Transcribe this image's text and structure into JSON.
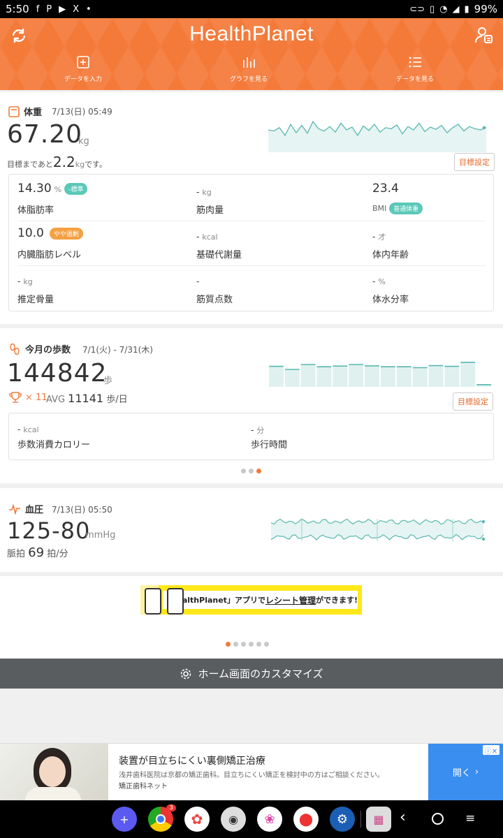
{
  "status": {
    "time": "5:50",
    "left_icons": [
      "facebook-icon",
      "pinterest-icon",
      "youtube-icon",
      "x-icon",
      "dot-icon"
    ],
    "battery": "99%"
  },
  "header": {
    "logo": "HealthPlanet",
    "nav": [
      {
        "label": "データを入力",
        "icon": "plus-square-icon"
      },
      {
        "label": "グラフを見る",
        "icon": "bar-chart-icon"
      },
      {
        "label": "データを見る",
        "icon": "list-icon"
      }
    ]
  },
  "weight": {
    "title": "体重",
    "date": "7/13(日) 05:49",
    "value": "67.20",
    "unit": "kg",
    "goal_prefix": "目標まであと",
    "goal_value": "2.2",
    "goal_unit": "kg",
    "goal_suffix": "です。",
    "goal_button": "目標設定",
    "metrics": [
      {
        "value": "14.30",
        "unit": "%",
        "badge": "-標準",
        "badge_color": "#5bc8b8",
        "label": "体脂肪率"
      },
      {
        "value": "-",
        "unit": "kg",
        "badge": "",
        "label": "筋肉量"
      },
      {
        "value": "23.4",
        "unit": "",
        "badge": "",
        "label": "BMI",
        "label_badge": "普通体重",
        "label_badge_color": "#5bc8b8"
      },
      {
        "value": "10.0",
        "unit": "",
        "badge": "やや過剰",
        "badge_color": "#f5a042",
        "label": "内臓脂肪レベル"
      },
      {
        "value": "-",
        "unit": "kcal",
        "badge": "",
        "label": "基礎代謝量"
      },
      {
        "value": "-",
        "unit": "才",
        "badge": "",
        "label": "体内年齢"
      },
      {
        "value": "-",
        "unit": "kg",
        "badge": "",
        "label": "推定骨量"
      },
      {
        "value": "-",
        "unit": "",
        "badge": "",
        "label": "筋質点数"
      },
      {
        "value": "-",
        "unit": "%",
        "badge": "",
        "label": "体水分率"
      }
    ],
    "sparkline": [
      40,
      38,
      44,
      30,
      50,
      35,
      48,
      34,
      55,
      42,
      38,
      46,
      36,
      52,
      40,
      45,
      30,
      47,
      39,
      50,
      36,
      44,
      42,
      49,
      33,
      46,
      40,
      52,
      37,
      45,
      41,
      48,
      35,
      44,
      50,
      38,
      46,
      42,
      40,
      44
    ]
  },
  "steps": {
    "title": "今月の歩数",
    "date": "7/1(火) - 7/31(木)",
    "value": "144842",
    "unit": "歩",
    "trophy_count": "× 11",
    "avg_label": "AVG",
    "avg_value": "11141",
    "avg_unit": "歩/日",
    "goal_button": "目標設定",
    "calories_value": "-",
    "calories_unit": "kcal",
    "calories_label": "歩数消費カロリー",
    "time_value": "-",
    "time_unit": "分",
    "time_label": "歩行時間",
    "bars": [
      0.92,
      0.78,
      1.0,
      0.9,
      0.93,
      1.0,
      0.94,
      0.9,
      0.9,
      0.86,
      0.95,
      0.92,
      1.1,
      0.1
    ]
  },
  "bp": {
    "title": "血圧",
    "date": "7/13(日) 05:50",
    "value": "125-80",
    "unit": "mmHg",
    "pulse_label": "脈拍",
    "pulse_value": "69",
    "pulse_unit": "拍/分"
  },
  "banner": {
    "text_prefix": "「HealthPlanet」アプリで",
    "text_highlight": "レシート管理",
    "text_suffix": "ができます!"
  },
  "customize": {
    "label": "ホーム画面のカスタマイズ"
  },
  "ad": {
    "title": "装置が目立ちにくい裏側矯正治療",
    "desc": "浅井歯科医院は京都の矯正歯科。目立ちにくい矯正を検討中の方はご相談ください。",
    "source": "矯正歯科ネット",
    "cta": "開く"
  },
  "dock": {
    "chrome_badge": "3"
  }
}
